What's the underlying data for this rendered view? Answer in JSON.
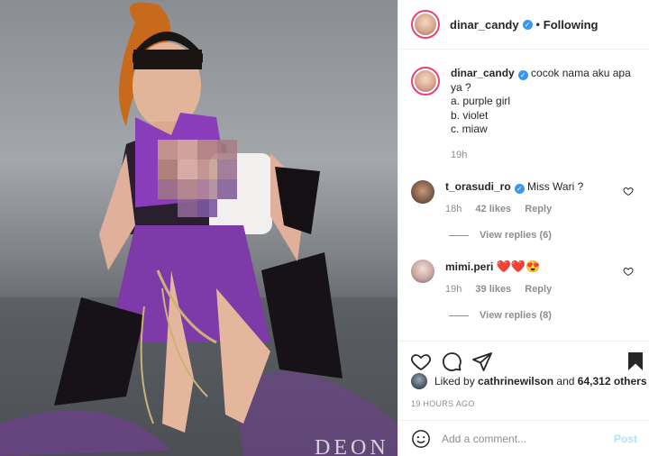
{
  "photo": {
    "watermark": "DEON"
  },
  "header": {
    "username": "dinar_candy",
    "follow_status": "Following",
    "separator": "•"
  },
  "caption": {
    "username": "dinar_candy",
    "lines": [
      "cocok nama aku apa ya ?",
      "a. purple girl",
      "b. violet",
      "c. miaw"
    ],
    "time": "19h"
  },
  "comments": [
    {
      "username": "t_orasudi_ro",
      "text": "Miss Wari ?",
      "time": "18h",
      "likes": "42 likes",
      "reply": "Reply",
      "view_replies": "View replies (6)"
    },
    {
      "username": "mimi.peri",
      "text": "❤️❤️😍",
      "time": "19h",
      "likes": "39 likes",
      "reply": "Reply",
      "view_replies": "View replies (8)"
    }
  ],
  "likes": {
    "prefix": "Liked by ",
    "user": "cathrinewilson",
    "middle": " and ",
    "others": "64,312 others"
  },
  "timeago": "19 HOURS AGO",
  "comment_box": {
    "placeholder": "Add a comment...",
    "post_label": "Post"
  },
  "icons": [
    "heart-icon",
    "comment-icon",
    "share-icon",
    "bookmark-icon",
    "smile-icon",
    "verified-icon"
  ]
}
